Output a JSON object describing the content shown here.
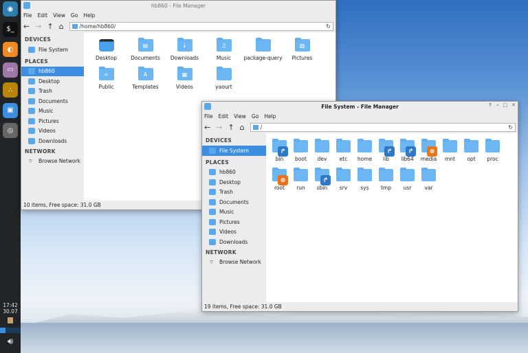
{
  "dock": {
    "items": [
      {
        "name": "app-launcher-icon",
        "color": "#2e7fb0",
        "glyph": "◉"
      },
      {
        "name": "terminal-icon",
        "color": "#111",
        "glyph": "$_"
      },
      {
        "name": "firefox-icon",
        "color": "#f08a24",
        "glyph": "◐"
      },
      {
        "name": "files-icon",
        "color": "#a078a8",
        "glyph": "▭"
      },
      {
        "name": "app-icon",
        "color": "#b8860b",
        "glyph": "∴"
      },
      {
        "name": "file-manager-icon",
        "color": "#3f8fe0",
        "glyph": "▣"
      },
      {
        "name": "disk-icon",
        "color": "#666",
        "glyph": "◎"
      }
    ],
    "time": "17:42",
    "date": "30.07"
  },
  "menu": [
    "File",
    "Edit",
    "View",
    "Go",
    "Help"
  ],
  "win1": {
    "title": "hb860 - File Manager",
    "path": "/home/hb860/",
    "devices_header": "DEVICES",
    "places_header": "PLACES",
    "network_header": "NETWORK",
    "devices": [
      "File System"
    ],
    "places": [
      "hb860",
      "Desktop",
      "Trash",
      "Documents",
      "Music",
      "Pictures",
      "Videos",
      "Downloads"
    ],
    "network": [
      "Browse Network"
    ],
    "items": [
      {
        "label": "Desktop",
        "type": "desktop"
      },
      {
        "label": "Documents",
        "glyph": "▤"
      },
      {
        "label": "Downloads",
        "glyph": "↓"
      },
      {
        "label": "Music",
        "glyph": "♫"
      },
      {
        "label": "package-query"
      },
      {
        "label": "Pictures",
        "glyph": "▨"
      },
      {
        "label": "Public",
        "glyph": "<"
      },
      {
        "label": "Templates",
        "glyph": "A"
      },
      {
        "label": "Videos",
        "glyph": "▦"
      },
      {
        "label": "yaourt"
      }
    ],
    "status": "10 items, Free space: 31.0 GB"
  },
  "win2": {
    "title": "File System - File Manager",
    "path": "/",
    "items": [
      {
        "label": "bin",
        "emblem": "link"
      },
      {
        "label": "boot"
      },
      {
        "label": "dev"
      },
      {
        "label": "etc"
      },
      {
        "label": "home"
      },
      {
        "label": "lib",
        "emblem": "link"
      },
      {
        "label": "lib64",
        "emblem": "link"
      },
      {
        "label": "media",
        "emblem": "locked"
      },
      {
        "label": "mnt"
      },
      {
        "label": "opt"
      },
      {
        "label": "proc"
      },
      {
        "label": "root",
        "emblem": "locked"
      },
      {
        "label": "run"
      },
      {
        "label": "sbin",
        "emblem": "link"
      },
      {
        "label": "srv"
      },
      {
        "label": "sys"
      },
      {
        "label": "tmp"
      },
      {
        "label": "usr"
      },
      {
        "label": "var"
      }
    ],
    "status": "19 items, Free space: 31.0 GB"
  }
}
